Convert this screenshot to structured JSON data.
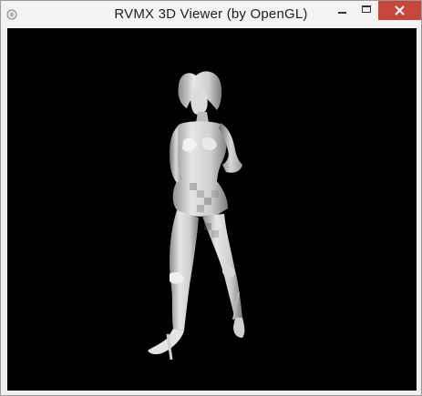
{
  "window": {
    "title": "RVMX 3D Viewer (by OpenGL)"
  },
  "icons": {
    "app": "app-icon",
    "minimize": "minimize-icon",
    "maximize": "maximize-icon",
    "close": "close-icon"
  },
  "colors": {
    "titlebar": "#f3f3f3",
    "close_button": "#c7473a",
    "viewport_background": "#000000",
    "model": "#d9d9d9"
  }
}
